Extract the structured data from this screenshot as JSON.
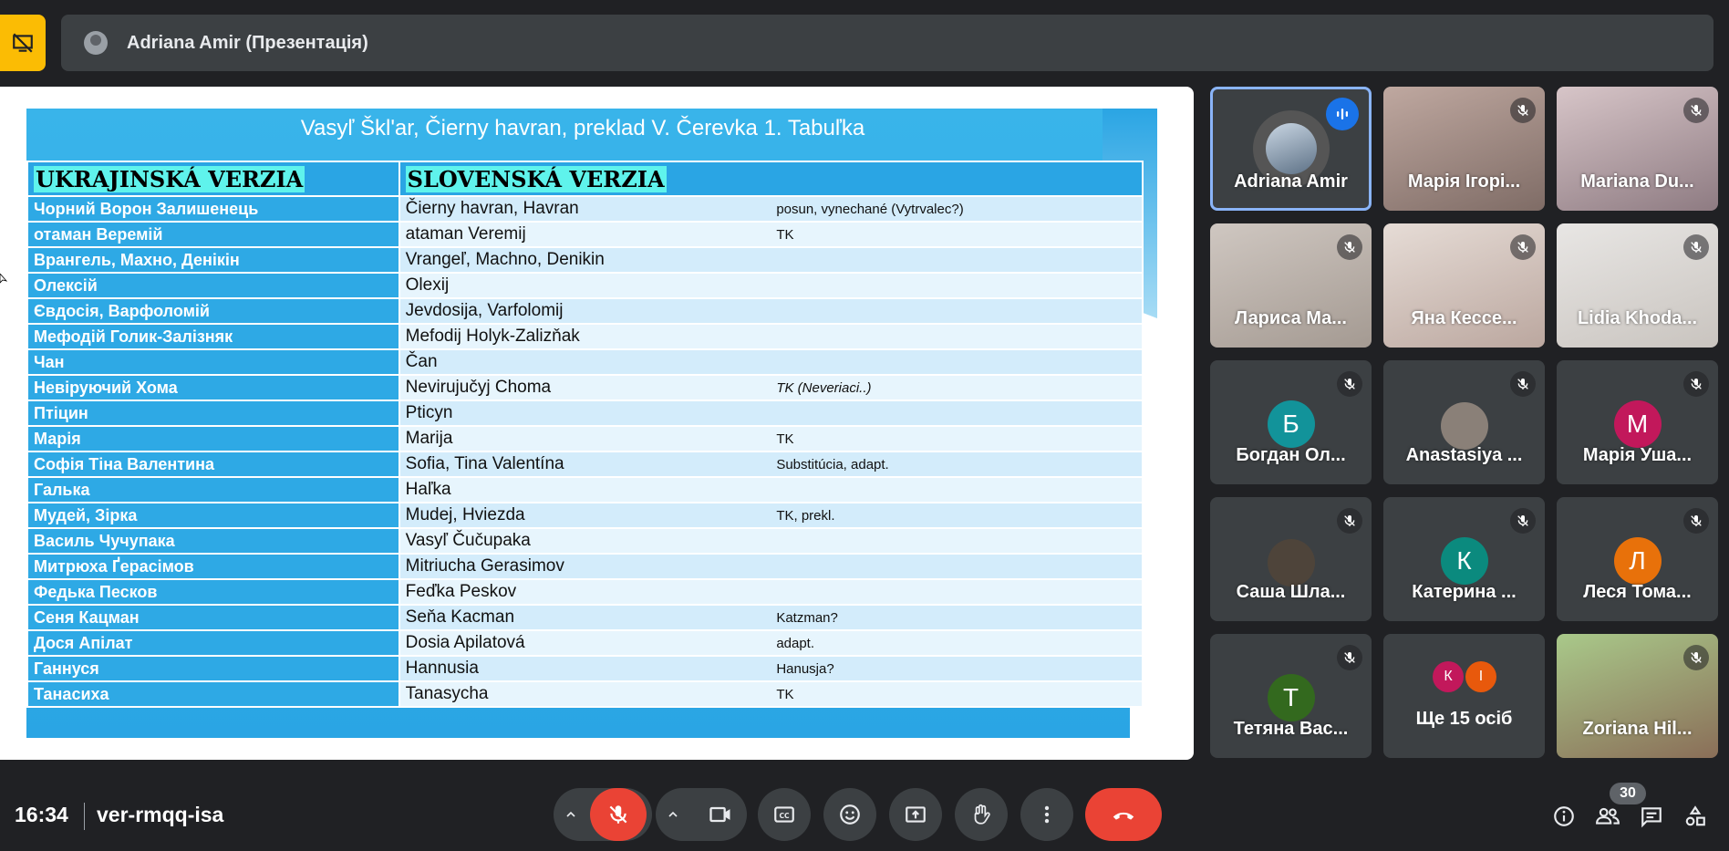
{
  "top": {
    "presenter_title": "Adriana Amir (Презентація)"
  },
  "slide": {
    "title": "Vasyľ Šklʹar, Čierny havran, preklad V. Čerevka 1. Tabuľka",
    "col_uk": "UKRAJINSKÁ VERZIA",
    "col_sk": "SLOVENSKÁ VERZIA",
    "rows": [
      {
        "uk": "Чорний Ворон Залишенець",
        "sk": "Čierny havran, Havran",
        "note": "posun, vynechané (Vytrvalec?)"
      },
      {
        "uk": "отаман Веремій",
        "sk": "ataman Veremij",
        "note": "TK"
      },
      {
        "uk": "Врангель, Махно, Денікін",
        "sk": "Vrangeľ, Machno, Denikin",
        "note": ""
      },
      {
        "uk": "Олексій",
        "sk": "Olexij",
        "note": ""
      },
      {
        "uk": "Євдосія, Варфоломій",
        "sk": "Jevdosija, Varfolomij",
        "note": ""
      },
      {
        "uk": "Мефодій Голик-Залізняк",
        "sk": "Mefodij Holyk-Zalizňak",
        "note": ""
      },
      {
        "uk": "Чан",
        "sk": "Čan",
        "note": ""
      },
      {
        "uk": "Невіруючий Хома",
        "sk": "Nevirujučyj Choma",
        "note": "TK (Neveriaci..)"
      },
      {
        "uk": "Птіцин",
        "sk": "Pticyn",
        "note": ""
      },
      {
        "uk": "Марія",
        "sk": "Marija",
        "note": "TK"
      },
      {
        "uk": "Софія Тіна Валентина",
        "sk": "Sofia, Tina Valentína",
        "note": "Substitúcia, adapt."
      },
      {
        "uk": "Галька",
        "sk": "Haľka",
        "note": ""
      },
      {
        "uk": "Мудей, Зірка",
        "sk": "Mudej, Hviezda",
        "note": "TK, prekl."
      },
      {
        "uk": "Василь Чучупака",
        "sk": "Vasyľ Čučupaka",
        "note": ""
      },
      {
        "uk": "Митрюха Ґерасімов",
        "sk": "Mitriucha Gerasimov",
        "note": ""
      },
      {
        "uk": "Федька Песков",
        "sk": "Feďka Peskov",
        "note": ""
      },
      {
        "uk": "Сеня Кацман",
        "sk": "Seňa Kacman",
        "note": "Katzman?"
      },
      {
        "uk": "Дося Апілат",
        "sk": "Dosia Apilatová",
        "note": "adapt."
      },
      {
        "uk": "Ганнуся",
        "sk": "Hannusia",
        "note": "Hanusja?"
      },
      {
        "uk": "Танасиха",
        "sk": "Tanasycha",
        "note": "TK"
      }
    ]
  },
  "participants": [
    {
      "name": "Adriana Amir"
    },
    {
      "name": "Марія Ігорі..."
    },
    {
      "name": "Mariana Du..."
    },
    {
      "name": "Лариса Ма..."
    },
    {
      "name": "Яна Кессе..."
    },
    {
      "name": "Lidia Khoda..."
    },
    {
      "name": "Богдан Ол...",
      "letter": "Б",
      "color": "#12939a"
    },
    {
      "name": "Anastasiya ..."
    },
    {
      "name": "Марія Уша...",
      "letter": "М",
      "color": "#c2185b"
    },
    {
      "name": "Саша Шла..."
    },
    {
      "name": "Катерина ...",
      "letter": "К",
      "color": "#0b8a7e"
    },
    {
      "name": "Леся Тома...",
      "letter": "Л",
      "color": "#e8710a"
    },
    {
      "name": "Тетяна Вас...",
      "letter": "Т",
      "color": "#33691e"
    },
    {
      "name": "Ще 15 осіб",
      "mini": [
        "К",
        "І"
      ],
      "mini_colors": [
        "#c2185b",
        "#e8590c"
      ]
    },
    {
      "name": "Zoriana Hil..."
    }
  ],
  "bottom": {
    "time": "16:34",
    "meeting_code": "ver-rmqq-isa",
    "participant_count": "30"
  }
}
